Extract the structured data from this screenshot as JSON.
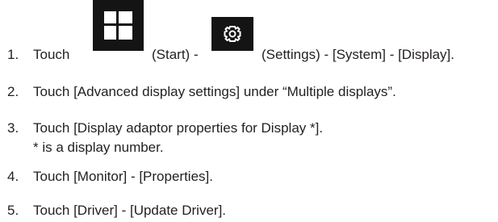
{
  "steps": [
    {
      "number": "1.",
      "touch": "Touch",
      "start": "(Start) -",
      "rest": "(Settings) - [System] - [Display]."
    },
    {
      "number": "2.",
      "text": "Touch [Advanced display settings] under “Multiple displays”."
    },
    {
      "number": "3.",
      "text": "Touch [Display adaptor properties for Display *].",
      "note": "* is a display number."
    },
    {
      "number": "4.",
      "text": "Touch [Monitor] - [Properties]."
    },
    {
      "number": "5.",
      "text": "Touch [Driver] - [Update Driver]."
    }
  ],
  "icons": {
    "start": "windows-start-icon",
    "settings": "settings-gear-icon"
  }
}
